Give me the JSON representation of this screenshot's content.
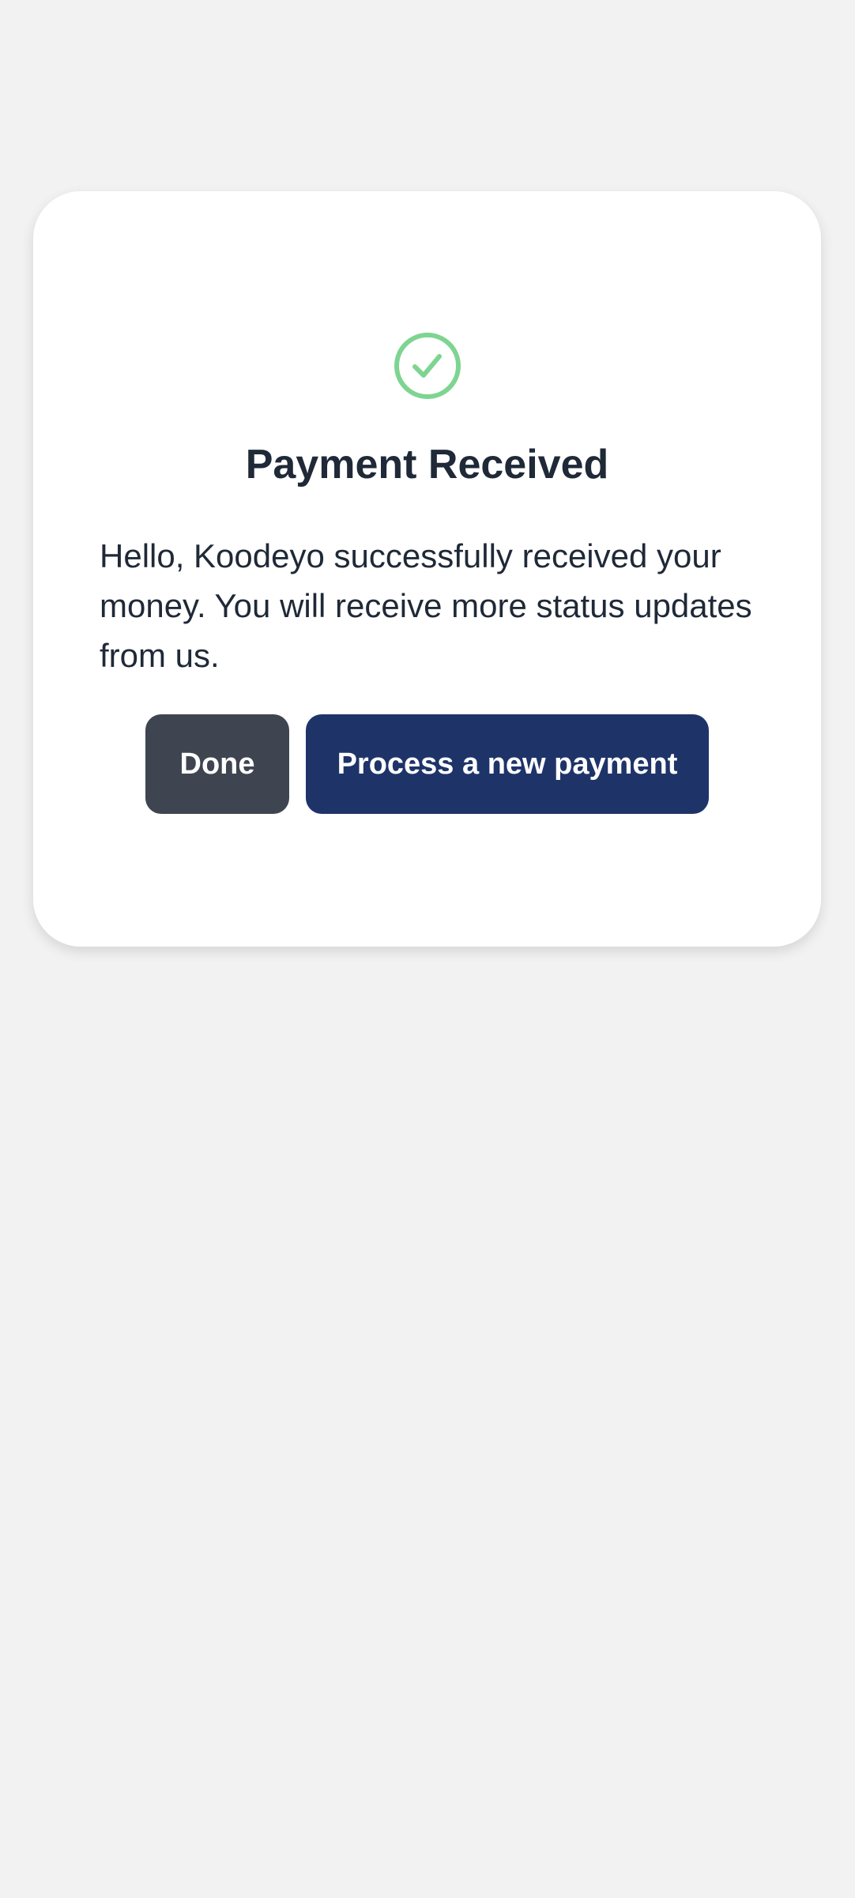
{
  "card": {
    "title": "Payment Received",
    "message": "Hello, Koodeyo successfully received your money. You will receive more status updates from us.",
    "icon": "check-circle-icon"
  },
  "actions": {
    "done_label": "Done",
    "new_payment_label": "Process a new payment"
  },
  "colors": {
    "background": "#f2f2f2",
    "card": "#ffffff",
    "success_icon": "#7ed491",
    "done_button": "#3f4550",
    "primary_button": "#1e3469",
    "text": "#1f2937"
  }
}
